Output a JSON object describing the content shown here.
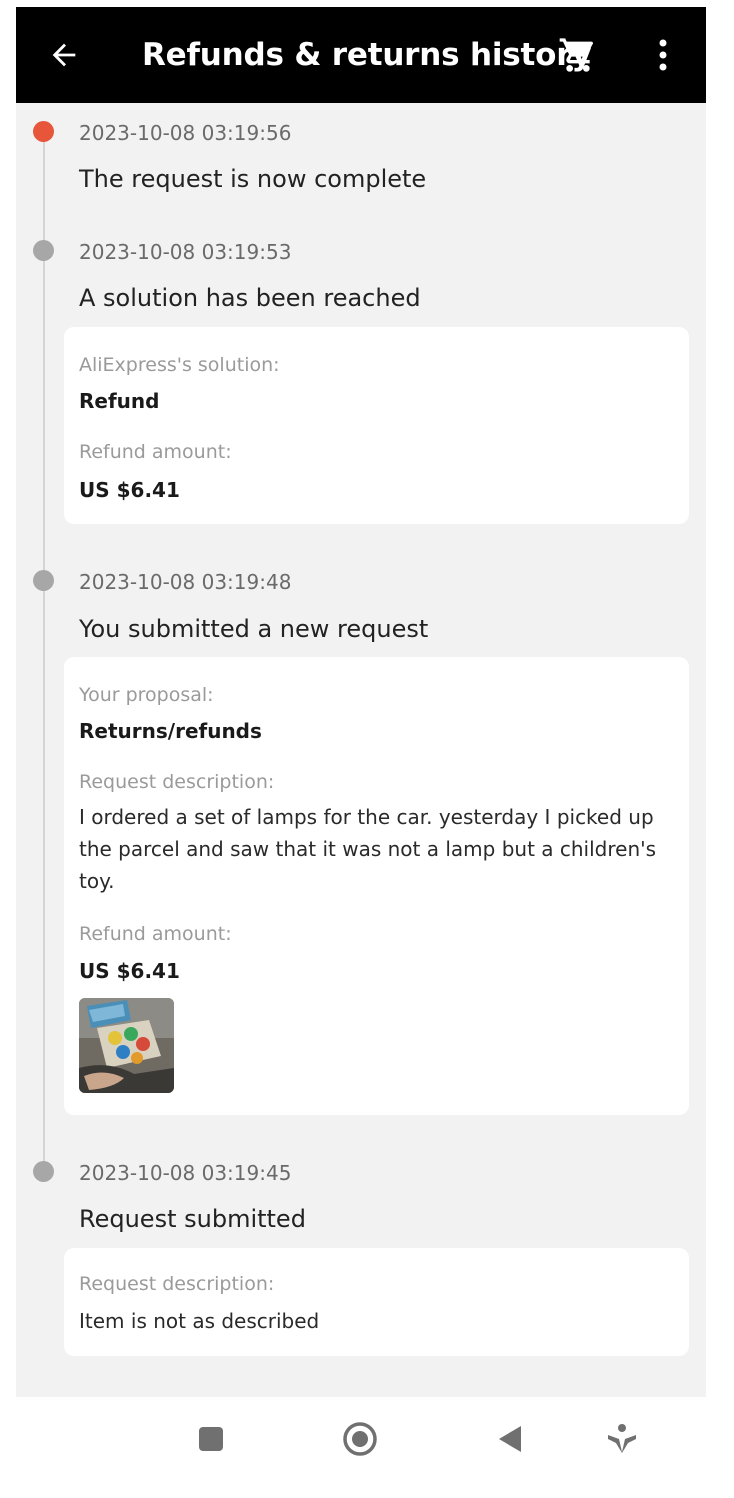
{
  "header": {
    "title": "Refunds & returns history",
    "back_icon": "arrow-left-icon",
    "cart_icon": "cart-icon",
    "more_icon": "more-vertical-icon"
  },
  "colors": {
    "active_dot": "#e7553a",
    "inactive_dot": "#a7a7a7",
    "topbar": "#000000",
    "background": "#f2f2f2"
  },
  "events": [
    {
      "timestamp": "2023-10-08 03:19:56",
      "title": "The request is now complete"
    },
    {
      "timestamp": "2023-10-08 03:19:53",
      "title": "A solution has been reached",
      "solution_label": "AliExpress's solution:",
      "solution_value": "Refund",
      "refund_label": "Refund amount:",
      "refund_value": "US $6.41"
    },
    {
      "timestamp": "2023-10-08 03:19:48",
      "title": "You submitted a new request",
      "proposal_label": "Your proposal:",
      "proposal_value": "Returns/refunds",
      "description_label": "Request description:",
      "description_text": "I ordered a set of lamps for the car. yesterday I picked up the parcel and saw that it was not a lamp but a children's toy.",
      "refund_label": "Refund amount:",
      "refund_value": "US $6.41"
    },
    {
      "timestamp": "2023-10-08 03:19:45",
      "title": "Request submitted",
      "description_label": "Request description:",
      "description_text": "Item is not as described"
    }
  ],
  "navbar": {
    "icons": [
      "square-icon",
      "circle-icon",
      "triangle-back-icon",
      "accessibility-icon"
    ]
  }
}
